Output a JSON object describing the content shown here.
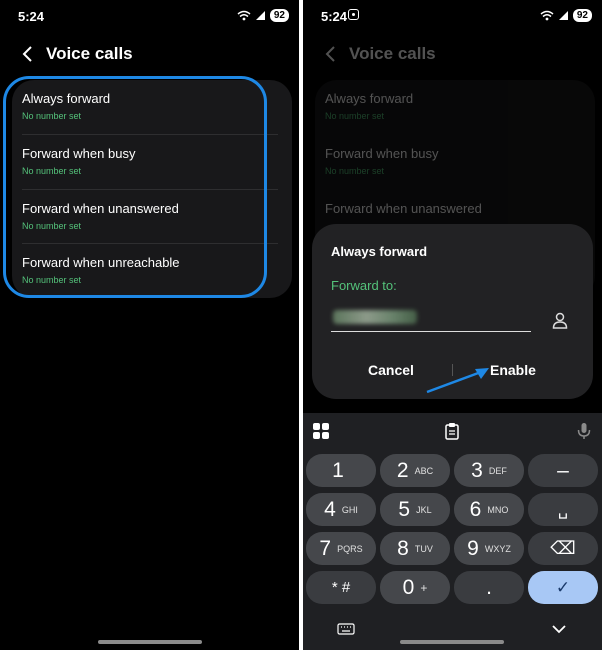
{
  "left_screen": {
    "status": {
      "time": "5:24",
      "battery": "92"
    },
    "title": "Voice calls",
    "options": [
      {
        "label": "Always forward",
        "status": "No number set"
      },
      {
        "label": "Forward when busy",
        "status": "No number set"
      },
      {
        "label": "Forward when unanswered",
        "status": "No number set"
      },
      {
        "label": "Forward when unreachable",
        "status": "No number set"
      }
    ],
    "highlight_color": "#1e88e5"
  },
  "right_screen": {
    "status": {
      "time": "5:24",
      "battery": "92"
    },
    "title": "Voice calls",
    "options": [
      {
        "label": "Always forward",
        "status": "No number set"
      },
      {
        "label": "Forward when busy",
        "status": "No number set"
      },
      {
        "label": "Forward when unanswered",
        "status": ""
      }
    ],
    "dialog": {
      "title": "Always forward",
      "field_label": "Forward to:",
      "cancel": "Cancel",
      "enable": "Enable"
    },
    "keypad": {
      "keys": [
        {
          "num": "1",
          "letters": ""
        },
        {
          "num": "2",
          "letters": "ABC"
        },
        {
          "num": "3",
          "letters": "DEF"
        },
        {
          "num": "–",
          "letters": ""
        },
        {
          "num": "4",
          "letters": "GHI"
        },
        {
          "num": "5",
          "letters": "JKL"
        },
        {
          "num": "6",
          "letters": "MNO"
        },
        {
          "num": "␣",
          "letters": ""
        },
        {
          "num": "7",
          "letters": "PQRS"
        },
        {
          "num": "8",
          "letters": "TUV"
        },
        {
          "num": "9",
          "letters": "WXYZ"
        },
        {
          "num": "⌫",
          "letters": ""
        },
        {
          "num": "* #",
          "letters": ""
        },
        {
          "num": "0",
          "letters": "+"
        },
        {
          "num": ".",
          "letters": ""
        },
        {
          "num": "✓",
          "letters": ""
        }
      ]
    }
  },
  "colors": {
    "accent_green": "#54c27a",
    "arrow_blue": "#1e88e5",
    "confirm_key": "#a8c8f5"
  }
}
